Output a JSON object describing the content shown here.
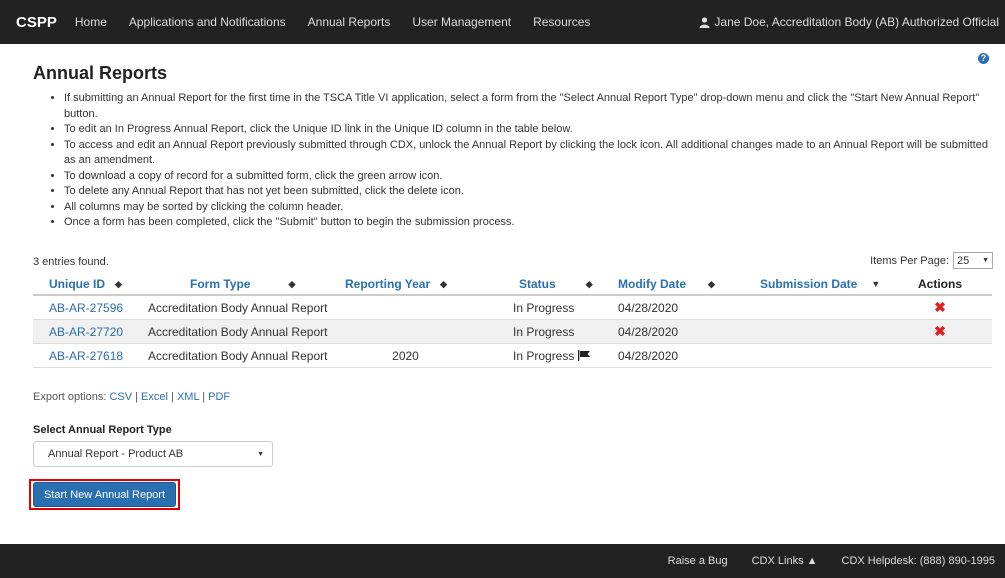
{
  "navbar": {
    "brand": "CSPP",
    "links": [
      "Home",
      "Applications and Notifications",
      "Annual Reports",
      "User Management",
      "Resources"
    ],
    "user": "Jane Doe, Accreditation Body (AB) Authorized Official"
  },
  "page": {
    "title": "Annual Reports",
    "instructions": [
      "If submitting an Annual Report for the first time in the TSCA Title VI application, select a form from the \"Select Annual Report Type\" drop-down menu and click the \"Start New Annual Report\" button.",
      "To edit an In Progress Annual Report, click the Unique ID link in the Unique ID column in the table below.",
      "To access and edit an Annual Report previously submitted through CDX, unlock the Annual Report by clicking the lock icon. All additional changes made to an Annual Report will be submitted as an amendment.",
      "To download a copy of record for a submitted form, click the green arrow icon.",
      "To delete any Annual Report that has not yet been submitted, click the delete icon.",
      "All columns may be sorted by clicking the column header.",
      "Once a form has been completed, click the \"Submit\" button to begin the submission process."
    ]
  },
  "table": {
    "entries_found": "3 entries found.",
    "items_per_page_label": "Items Per Page:",
    "items_per_page_value": "25",
    "headers": {
      "unique_id": "Unique ID",
      "form_type": "Form Type",
      "reporting_year": "Reporting Year",
      "status": "Status",
      "modify_date": "Modify Date",
      "submission_date": "Submission Date",
      "actions": "Actions"
    },
    "rows": [
      {
        "unique_id": "AB-AR-27596",
        "form_type": "Accreditation Body Annual Report",
        "reporting_year": "",
        "status": "In Progress",
        "modify_date": "04/28/2020",
        "submission_date": "",
        "delete": "✖"
      },
      {
        "unique_id": "AB-AR-27720",
        "form_type": "Accreditation Body Annual Report",
        "reporting_year": "",
        "status": "In Progress",
        "modify_date": "04/28/2020",
        "submission_date": "",
        "delete": "✖"
      },
      {
        "unique_id": "AB-AR-27618",
        "form_type": "Accreditation Body Annual Report",
        "reporting_year": "2020",
        "status": "In Progress",
        "modify_date": "04/28/2020",
        "submission_date": "",
        "delete": ""
      }
    ]
  },
  "export": {
    "label": "Export options:",
    "csv": "CSV",
    "excel": "Excel",
    "xml": "XML",
    "pdf": "PDF",
    "separator": "|"
  },
  "form": {
    "select_label": "Select Annual Report Type",
    "select_value": "Annual Report - Product AB",
    "start_button": "Start New Annual Report"
  },
  "footer": {
    "raise_bug": "Raise a Bug",
    "cdx_links": "CDX Links ▲",
    "helpdesk": "CDX Helpdesk: (888) 890-1995"
  },
  "colors": {
    "navbar_bg": "#222222",
    "link": "#2a6fb0",
    "button": "#2a6fb0",
    "delete": "#e02020",
    "highlight": "#e00000"
  }
}
